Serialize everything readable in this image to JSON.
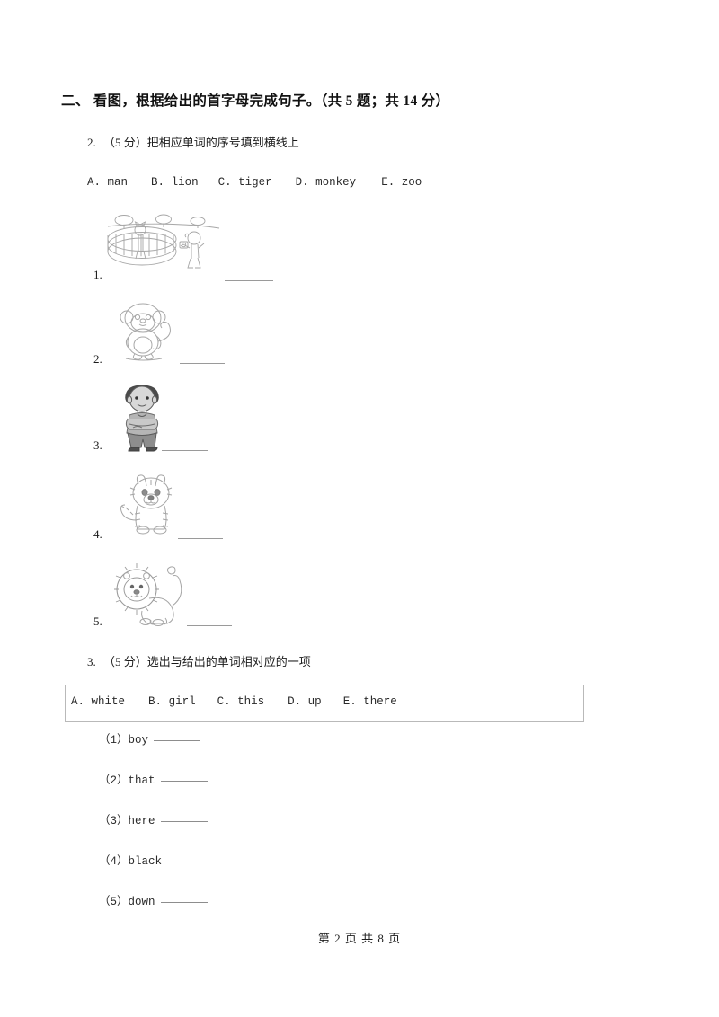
{
  "section": {
    "heading": "二、  看图，根据给出的首字母完成句子。（共 5 题；共 14 分）"
  },
  "question2": {
    "number": "2.",
    "stem": "（5 分）把相应单词的序号填到横线上",
    "options": [
      {
        "letter": "A.",
        "word": "man"
      },
      {
        "letter": "B.",
        "word": "lion"
      },
      {
        "letter": "C.",
        "word": "tiger"
      },
      {
        "letter": "D.",
        "word": "monkey"
      },
      {
        "letter": "E.",
        "word": "zoo"
      }
    ],
    "items": [
      {
        "index": "1.",
        "picture": "zoo-cage-scene"
      },
      {
        "index": "2.",
        "picture": "monkey"
      },
      {
        "index": "3.",
        "picture": "man-boy-standing"
      },
      {
        "index": "4.",
        "picture": "tiger"
      },
      {
        "index": "5.",
        "picture": "lion"
      }
    ]
  },
  "question3": {
    "number": "3.",
    "stem": "（5 分）选出与给出的单词相对应的一项",
    "options": [
      {
        "letter": "A.",
        "word": "white"
      },
      {
        "letter": "B.",
        "word": "girl"
      },
      {
        "letter": "C.",
        "word": "this"
      },
      {
        "letter": "D.",
        "word": "up"
      },
      {
        "letter": "E.",
        "word": "there"
      }
    ],
    "subitems": [
      {
        "label": "（1）boy"
      },
      {
        "label": "（2）that"
      },
      {
        "label": "（3）here"
      },
      {
        "label": "（4）black"
      },
      {
        "label": "（5）down"
      }
    ]
  },
  "footer": {
    "text": "第 2 页 共 8 页"
  },
  "colors": {
    "page_background": "#ffffff",
    "text": "#1a1a1a",
    "blank_rule": "#9a9a9a",
    "box_border": "#b9b9b9",
    "artwork_ink": "#9b9b9b"
  }
}
